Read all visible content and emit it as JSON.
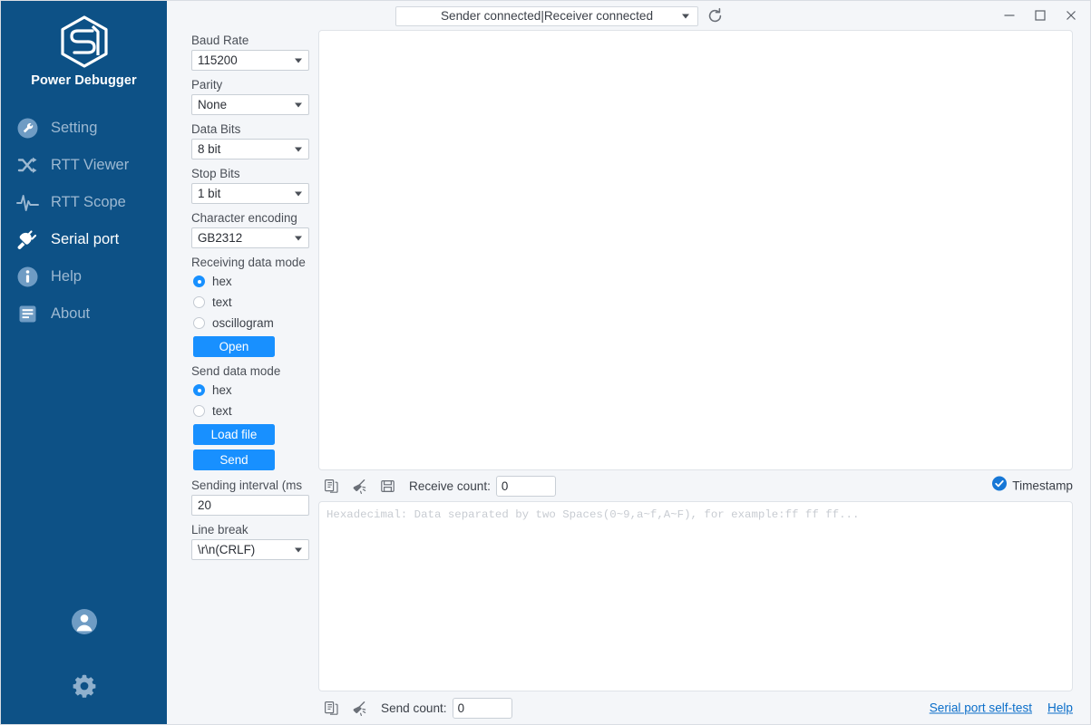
{
  "app": {
    "name": "Power Debugger",
    "logo_icon": "cube-logo-icon"
  },
  "sidebar": {
    "items": [
      {
        "label": "Setting",
        "icon": "wrench-circle-icon",
        "active": false
      },
      {
        "label": "RTT Viewer",
        "icon": "shuffle-icon",
        "active": false
      },
      {
        "label": "RTT Scope",
        "icon": "waveform-icon",
        "active": false
      },
      {
        "label": "Serial port",
        "icon": "power-plug-icon",
        "active": true
      },
      {
        "label": "Help",
        "icon": "info-circle-icon",
        "active": false
      },
      {
        "label": "About",
        "icon": "document-list-icon",
        "active": false
      }
    ],
    "bottom": [
      {
        "name": "account-avatar-icon",
        "icon": "user-circle-icon"
      },
      {
        "name": "settings-gear-icon",
        "icon": "gear-icon"
      }
    ]
  },
  "settings": {
    "baud_rate": {
      "label": "Baud Rate",
      "value": "115200"
    },
    "parity": {
      "label": "Parity",
      "value": "None"
    },
    "data_bits": {
      "label": "Data Bits",
      "value": "8 bit"
    },
    "stop_bits": {
      "label": "Stop Bits",
      "value": "1 bit"
    },
    "encoding": {
      "label": "Character encoding",
      "value": "GB2312"
    },
    "receiving_mode": {
      "label": "Receiving data mode",
      "options": [
        {
          "label": "hex",
          "selected": true
        },
        {
          "label": "text",
          "selected": false
        },
        {
          "label": "oscillogram",
          "selected": false
        }
      ]
    },
    "open_button": "Open",
    "send_mode": {
      "label": "Send data mode",
      "options": [
        {
          "label": "hex",
          "selected": true
        },
        {
          "label": "text",
          "selected": false
        }
      ]
    },
    "load_file_button": "Load file",
    "send_button": "Send",
    "sending_interval": {
      "label": "Sending  interval (ms",
      "value": "20"
    },
    "line_break": {
      "label": "Line break",
      "value": "\\r\\n(CRLF)"
    }
  },
  "titlebar": {
    "port_status": "Sender connected|Receiver connected",
    "refresh_icon": "refresh-icon",
    "window_controls": {
      "minimize": "minimize-icon",
      "maximize": "maximize-icon",
      "close": "close-icon"
    }
  },
  "receive_panel": {
    "content": "",
    "toolbar": {
      "copy_icon": "copy-document-icon",
      "clear_icon": "broom-clear-icon",
      "save_icon": "floppy-save-icon",
      "count_label": "Receive count:",
      "count_value": "0",
      "timestamp_label": "Timestamp",
      "timestamp_checked": true
    }
  },
  "send_panel": {
    "placeholder": "Hexadecimal: Data separated by two Spaces(0~9,a~f,A~F), for example:ff ff ff...",
    "value": "",
    "toolbar": {
      "copy_icon": "copy-document-icon",
      "clear_icon": "broom-clear-icon",
      "count_label": "Send count:",
      "count_value": "0"
    },
    "links": [
      {
        "label": "Serial port self-test"
      },
      {
        "label": "Help"
      }
    ]
  },
  "colors": {
    "sidebar_blue": "#0d5186",
    "accent_blue": "#1890ff",
    "link_blue": "#0b6ec9",
    "panel_bg": "#f4f6f9"
  }
}
